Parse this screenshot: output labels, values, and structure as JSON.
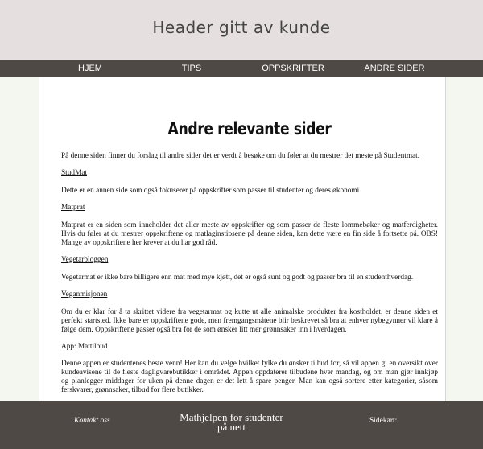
{
  "header": {
    "title": "Header gitt av kunde"
  },
  "nav": {
    "items": [
      {
        "label": "HJEM"
      },
      {
        "label": "TIPS"
      },
      {
        "label": "OPPSKRIFTER"
      },
      {
        "label": "ANDRE SIDER"
      }
    ]
  },
  "main": {
    "heading": "Andre relevante sider",
    "intro": "På denne siden finner du forslag til andre sider det er verdt å besøke om du føler at du mestrer det meste på Studentmat.",
    "sections": [
      {
        "title": "StudMat",
        "text": "Dette er en annen side som også fokuserer på oppskrifter som passer til studenter og deres økonomi."
      },
      {
        "title": "Matprat",
        "text": "Matprat er en siden som inneholder det aller meste av oppskrifter og som passer de fleste lommebøker og matferdigheter. Hvis du føler at du mestrer oppskriftene og matlaginstipsene på denne siden, kan dette være en fin side å fortsette på. OBS! Mange av oppskriftene her krever at du har god råd."
      },
      {
        "title": "Vegetarbloggen",
        "text": "Vegetarmat er ikke bare billigere enn mat med mye kjøtt, det er også sunt og godt og passer bra til en studenthverdag."
      },
      {
        "title": "Veganmisjonen",
        "text": "Om du er klar for å ta skrittet videre fra vegetarmat og kutte ut alle animalske produkter fra kostholdet, er denne siden et perfekt startsted. Ikke bare er oppskriftene gode, men fremgangsmåtene blir beskrevet så bra at enhver nybegynner vil klare å følge dem. Oppskriftene passer også bra for de som ønsker litt mer grønnsaker inn i hverdagen."
      }
    ],
    "app": {
      "title": "App: Mattilbud",
      "text": "Denne appen er studentenes beste venn! Her kan du velge hvilket fylke du ønsker tilbud for, så vil appen gi en oversikt over kundeavisene til de fleste dagligvarebutikker i området. Appen oppdaterer tilbudene hver mandag, og om man gjør innkjøp og planlegger middager for uken på denne dagen er det lett å spare penger. Man kan også sortere etter kategorier, såsom ferskvarer, grønnsaker, tilbud for flere butikker."
    }
  },
  "footer": {
    "contact": "Kontakt oss",
    "title_line1": "Mathjelpen for studenter",
    "title_line2": "på nett",
    "sitemap": "Sidekart:"
  }
}
